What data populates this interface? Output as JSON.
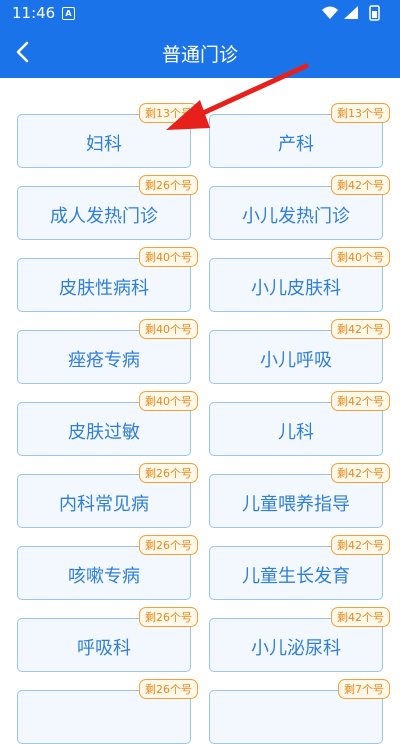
{
  "status_bar": {
    "time": "11:46",
    "notification_glyph": "A"
  },
  "nav": {
    "title": "普通门诊",
    "back_icon": "chevron-left-icon"
  },
  "departments": [
    {
      "name": "妇科",
      "quota": "剩13个号"
    },
    {
      "name": "产科",
      "quota": "剩13个号"
    },
    {
      "name": "成人发热门诊",
      "quota": "剩26个号"
    },
    {
      "name": "小儿发热门诊",
      "quota": "剩42个号"
    },
    {
      "name": "皮肤性病科",
      "quota": "剩40个号"
    },
    {
      "name": "小儿皮肤科",
      "quota": "剩40个号"
    },
    {
      "name": "痤疮专病",
      "quota": "剩40个号"
    },
    {
      "name": "小儿呼吸",
      "quota": "剩42个号"
    },
    {
      "name": "皮肤过敏",
      "quota": "剩40个号"
    },
    {
      "name": "儿科",
      "quota": "剩42个号"
    },
    {
      "name": "内科常见病",
      "quota": "剩26个号"
    },
    {
      "name": "儿童喂养指导",
      "quota": "剩42个号"
    },
    {
      "name": "咳嗽专病",
      "quota": "剩26个号"
    },
    {
      "name": "儿童生长发育",
      "quota": "剩42个号"
    },
    {
      "name": "呼吸科",
      "quota": "剩26个号"
    },
    {
      "name": "小儿泌尿科",
      "quota": "剩42个号"
    },
    {
      "name": "",
      "quota": "剩26个号"
    },
    {
      "name": "",
      "quota": "剩7个号"
    }
  ],
  "colors": {
    "primary": "#1a73e8",
    "card_border": "#9cc3ee",
    "card_text": "#2f7fd8",
    "badge": "#e8891a",
    "arrow": "#e8201c"
  }
}
